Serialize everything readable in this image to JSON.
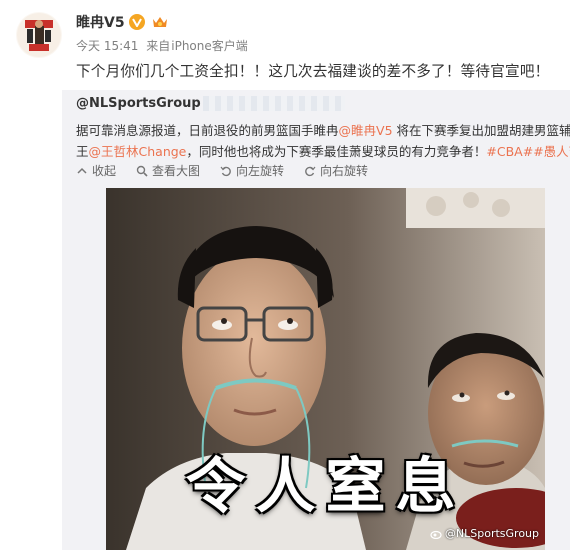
{
  "author": {
    "name": "睢冉V5"
  },
  "meta": {
    "time": "今天 15:41",
    "source_prefix": "来自",
    "source": "iPhone客户端"
  },
  "post": {
    "text": "下个月你们几个工资全扣！！这几次去福建谈的差不多了！等待官宣吧！"
  },
  "repost": {
    "orig_author": "@NLSportsGroup",
    "line1_pre": "据可靠消息源报道，日前退役的前男篮国手睢冉",
    "mention1": "@睢冉V5",
    "line1_post": " 将在下赛季复出加盟胡建男篮辅佐大",
    "line2_pre": "王",
    "mention2": "@王哲林Change",
    "line2_mid": "，同时他也将成为下赛季最佳萧叟球员的有力竞争者！",
    "tags": "#CBA##愚人节#",
    "actions": {
      "collapse": "收起",
      "view_large": "查看大图",
      "rotate_left": "向左旋转",
      "rotate_right": "向右旋转"
    },
    "image": {
      "caption": "令人窒息",
      "watermark": "@NLSportsGroup"
    }
  },
  "colors": {
    "link": "#eb7350",
    "repost_bg": "#f2f2f5",
    "badge": "#f5a623"
  },
  "icons": [
    "avatar",
    "vip-badge-icon",
    "member-crown-icon",
    "collapse-icon",
    "zoom-icon",
    "rotate-left-icon",
    "rotate-right-icon",
    "weibo-logo-icon"
  ]
}
